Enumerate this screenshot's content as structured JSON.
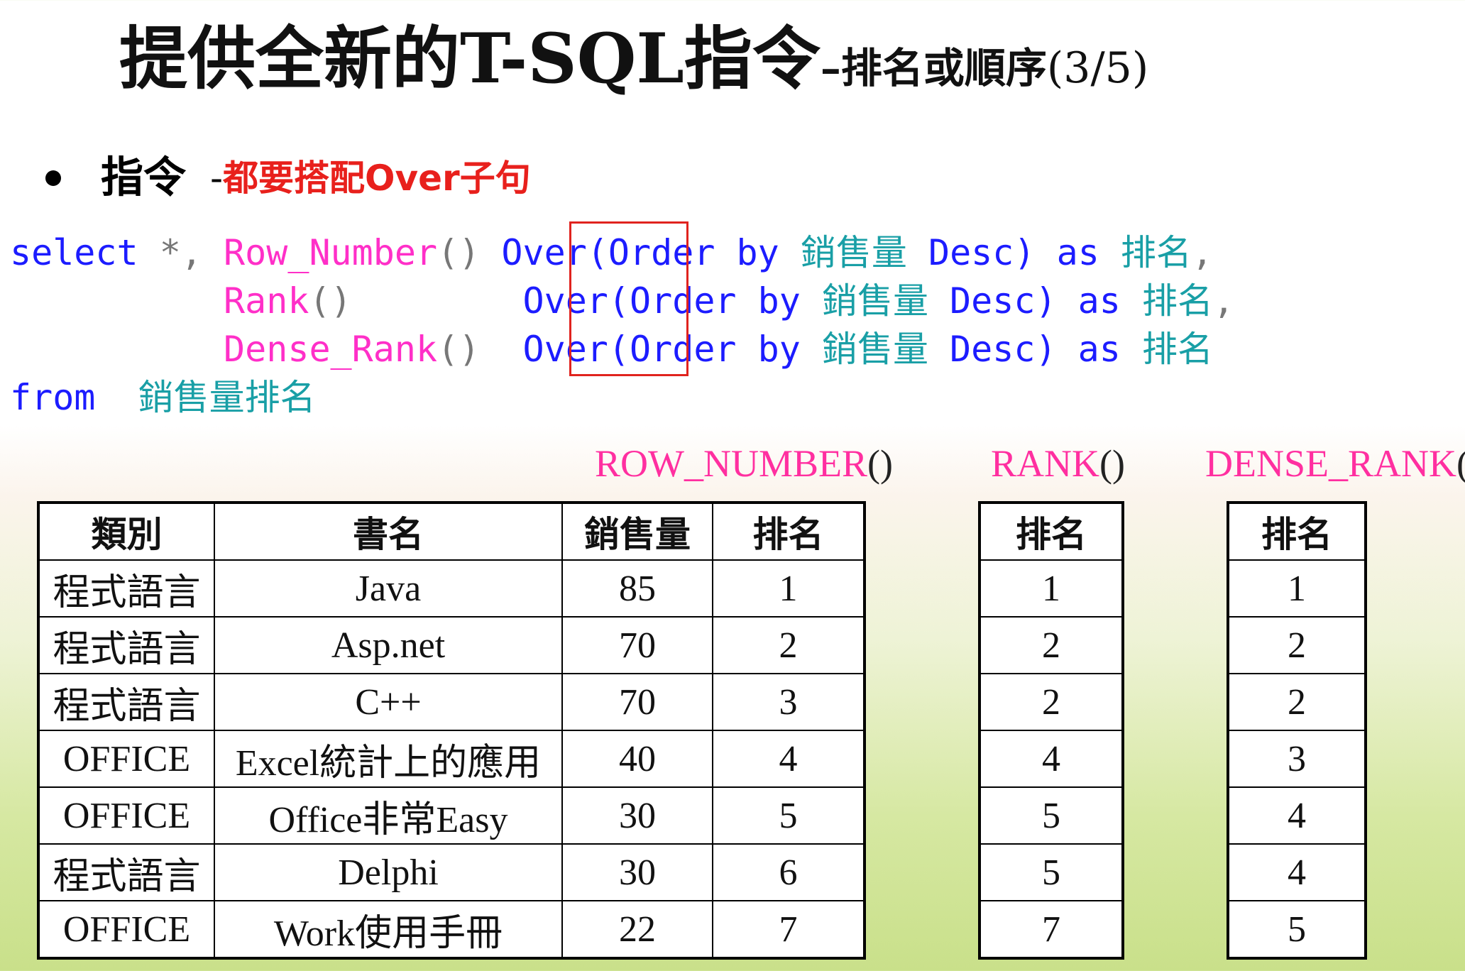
{
  "title": {
    "main": "提供全新的T-SQL指令",
    "dash": "–",
    "sub": "排名或順序",
    "page": "(3/5)"
  },
  "bullet": {
    "label": "指令",
    "note_dash": "-",
    "note": "都要搭配Over子句"
  },
  "code": {
    "line1": {
      "select": "select",
      "star": " *, ",
      "fn": "Row_Number",
      "parens": "()",
      "over": "Over",
      "order_open": "(Order by ",
      "col": "銷售量",
      "desc": " Desc)",
      "as": " as ",
      "alias": "排名",
      "comma": ","
    },
    "line2": {
      "fn": "Rank",
      "parens": "()",
      "over": "Over",
      "order_open": "(Order by ",
      "col": "銷售量",
      "desc": " Desc)",
      "as": " as ",
      "alias": "排名",
      "comma": ","
    },
    "line3": {
      "fn": "Dense_Rank",
      "parens": "()",
      "over": "Over",
      "order_open": "(Order by ",
      "col": "銷售量",
      "desc": " Desc)",
      "as": " as ",
      "alias": "排名"
    },
    "line4": {
      "from": "from",
      "table": "銷售量排名"
    }
  },
  "labels": {
    "row_number": "ROW_NUMBER",
    "rank": "RANK",
    "dense_rank": "DENSE_RANK",
    "parens": "()"
  },
  "main_table": {
    "headers": [
      "類別",
      "書名",
      "銷售量",
      "排名"
    ],
    "rows": [
      [
        "程式語言",
        "Java",
        "85",
        "1"
      ],
      [
        "程式語言",
        "Asp.net",
        "70",
        "2"
      ],
      [
        "程式語言",
        "C++",
        "70",
        "3"
      ],
      [
        "OFFICE",
        "Excel統計上的應用",
        "40",
        "4"
      ],
      [
        "OFFICE",
        "Office非常Easy",
        "30",
        "5"
      ],
      [
        "程式語言",
        "Delphi",
        "30",
        "6"
      ],
      [
        "OFFICE",
        "Work使用手冊",
        "22",
        "7"
      ]
    ]
  },
  "rank_table": {
    "header": "排名",
    "values": [
      "1",
      "2",
      "2",
      "4",
      "5",
      "5",
      "7"
    ]
  },
  "dense_table": {
    "header": "排名",
    "values": [
      "1",
      "2",
      "2",
      "3",
      "4",
      "4",
      "5"
    ]
  },
  "colors": {
    "keyword": "#1c1cff",
    "function": "#ff2fc8",
    "identifier": "#199fa6",
    "note": "#e8201c",
    "highlight_box": "#e0231e"
  }
}
